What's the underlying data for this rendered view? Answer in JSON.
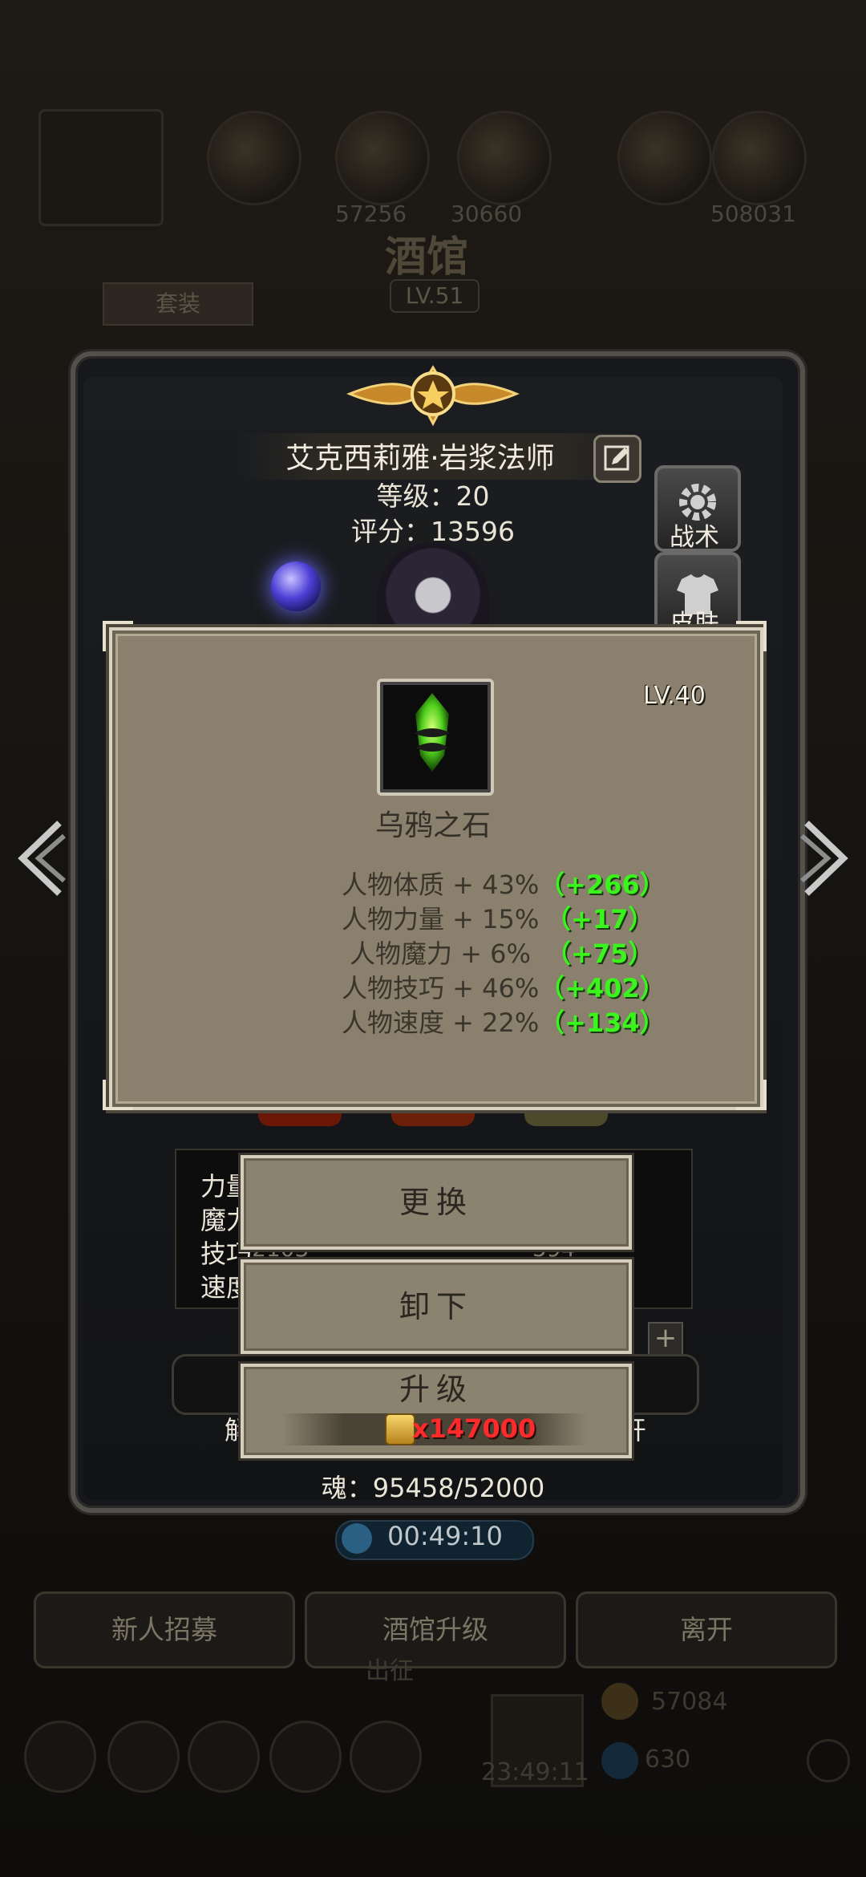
{
  "background": {
    "tavern_title": "酒馆",
    "tavern_level": "LV.51",
    "set_button": "套装",
    "resource_values": [
      "57256",
      "30660",
      "508031"
    ],
    "bottom_buttons": [
      "新人招募",
      "酒馆升级",
      "离开"
    ],
    "expedition_label": "出征",
    "gold_value": "57084",
    "gem_value": "630",
    "chest_timer": "23:49:11"
  },
  "hero": {
    "name": "艾克西莉雅·岩浆法师",
    "level": "等级：20",
    "score": "评分：13596",
    "tactics_label": "战术",
    "skin_label": "皮肤",
    "soul": "魂：95458/52000",
    "timer": "00:49:10"
  },
  "stats_peek": {
    "rows": [
      "力量",
      "魔力",
      "技巧",
      "速度"
    ],
    "skill_value": "2103",
    "other_value": "594"
  },
  "side_chars": {
    "left": "解",
    "right": "开"
  },
  "tooltip": {
    "level": "LV.40",
    "item_name": "乌鸦之石",
    "attributes": [
      {
        "label": "人物体质 + 43%",
        "bonus": "（+266）"
      },
      {
        "label": "人物力量 + 15%",
        "bonus": "（+17）"
      },
      {
        "label": "人物魔力 + 6%",
        "bonus": "（+75）"
      },
      {
        "label": "人物技巧 + 46%",
        "bonus": "（+402）"
      },
      {
        "label": "人物速度 + 22%",
        "bonus": "（+134）"
      }
    ]
  },
  "actions": {
    "replace": "更换",
    "unequip": "卸下",
    "upgrade": "升级",
    "upgrade_cost": "x147000"
  },
  "colors": {
    "bonus_green": "#39f51c",
    "cost_red": "#ff2a2a",
    "tooltip_bg": "#8a806d"
  }
}
